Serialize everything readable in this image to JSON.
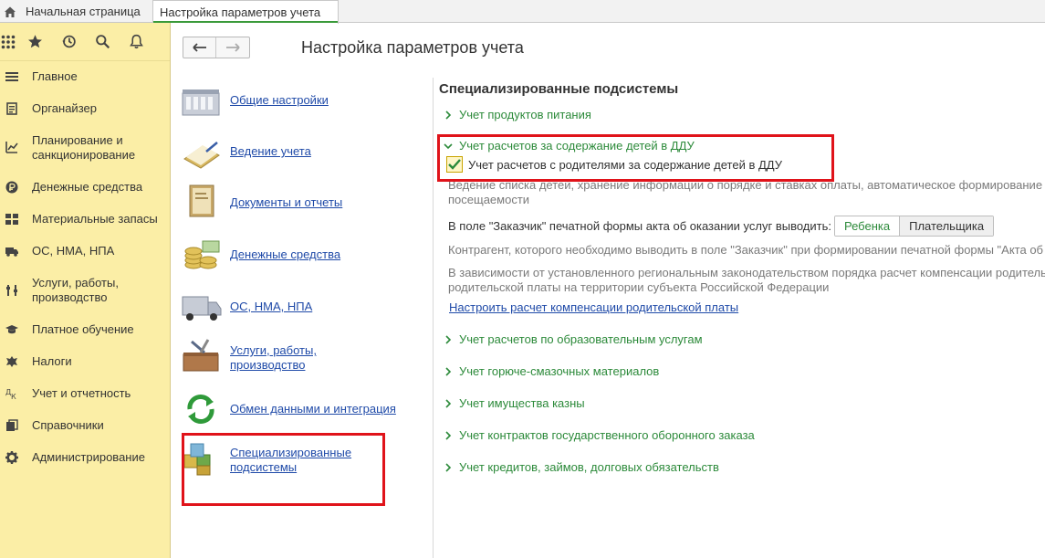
{
  "tabs": {
    "home_label": "Начальная страница",
    "active_label": "Настройка параметров учета"
  },
  "sidebar": {
    "items": [
      {
        "label": "Главное",
        "icon": "menu-lines-icon"
      },
      {
        "label": "Органайзер",
        "icon": "clipboard-icon"
      },
      {
        "label": "Планирование и\nсанкционирование",
        "icon": "planning-icon"
      },
      {
        "label": "Денежные средства",
        "icon": "ruble-coin-icon"
      },
      {
        "label": "Материальные запасы",
        "icon": "grid-blocks-icon"
      },
      {
        "label": "ОС, НМА, НПА",
        "icon": "truck-icon"
      },
      {
        "label": "Услуги, работы,\nпроизводство",
        "icon": "tools-icon"
      },
      {
        "label": "Платное обучение",
        "icon": "graduation-cap-icon"
      },
      {
        "label": "Налоги",
        "icon": "emblem-icon"
      },
      {
        "label": "Учет и отчетность",
        "icon": "accounting-icon"
      },
      {
        "label": "Справочники",
        "icon": "books-icon"
      },
      {
        "label": "Администрирование",
        "icon": "gear-icon"
      }
    ]
  },
  "page": {
    "title": "Настройка параметров учета"
  },
  "sections": [
    {
      "label": "Общие настройки",
      "icon": "building-icon"
    },
    {
      "label": "Ведение учета",
      "icon": "ledger-icon"
    },
    {
      "label": "Документы  и отчеты",
      "icon": "documents-icon"
    },
    {
      "label": "Денежные средства",
      "icon": "coins-icon"
    },
    {
      "label": "ОС, НМА, НПА",
      "icon": "van-icon"
    },
    {
      "label": "Услуги, работы,\nпроизводство",
      "icon": "toolbox-icon"
    },
    {
      "label": "Обмен данными и интеграция",
      "icon": "sync-arrows-icon"
    },
    {
      "label": "Специализированные\nподсистемы",
      "icon": "cubes-icon"
    }
  ],
  "right": {
    "title": "Специализированные подсистемы",
    "group_food": "Учет продуктов питания",
    "group_ddu": "Учет расчетов за содержание детей в ДДУ",
    "checkbox_label": "Учет расчетов с родителями за содержание детей в ДДУ",
    "checkbox_checked": true,
    "desc_ddu_line1": "Ведение списка детей, хранение информации о порядке и ставках оплаты, автоматическое формирование н",
    "desc_ddu_line2": "посещаемости",
    "customer_label": "В поле \"Заказчик\" печатной формы акта об оказании услуг выводить:",
    "customer_options": [
      "Ребенка",
      "Плательщика"
    ],
    "customer_selected": "Ребенка",
    "desc_customer": "Контрагент, которого необходимо выводить в поле \"Заказчик\" при формировании печатной формы \"Акта об о",
    "desc_comp_line1": "В зависимости от установленного региональным законодательством порядка расчет компенсации родитель",
    "desc_comp_line2": "родительской платы на территории субъекта Российской Федерации",
    "comp_link": "Настроить расчет компенсации родительской платы",
    "groups_rest": [
      "Учет расчетов по образовательным услугам",
      "Учет горюче-смазочных материалов",
      "Учет имущества казны",
      "Учет контрактов государственного оборонного заказа",
      "Учет кредитов, займов, долговых обязательств"
    ]
  },
  "colors": {
    "sidebar_bg": "#fbeea6",
    "link": "#1f4aa8",
    "group_green": "#2c8a3a",
    "highlight_red": "#e0131a"
  }
}
